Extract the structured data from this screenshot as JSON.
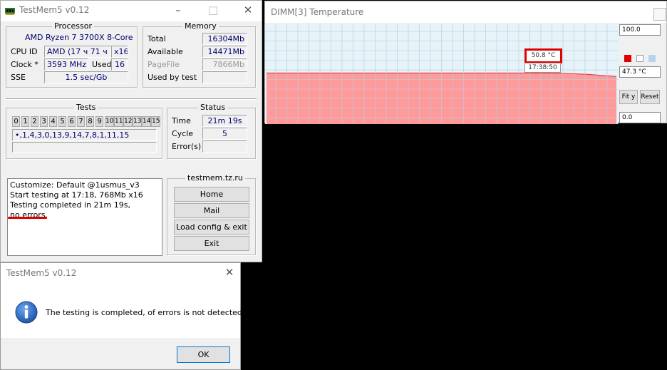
{
  "testmem": {
    "title": "TestMem5 v0.12",
    "processor": {
      "group": "Processor",
      "name": "AMD Ryzen 7 3700X 8-Core",
      "cpuid_label": "CPU ID",
      "cpuid_value": "AMD  (17 ч 71 ч",
      "cpuid_threads": "x16",
      "clock_label": "Clock *",
      "clock_value": "3593 MHz",
      "used_label": "Used",
      "used_value": "16",
      "sse_label": "SSE",
      "sse_value": "1.5 sec/Gb"
    },
    "memory": {
      "group": "Memory",
      "total_label": "Total",
      "total_value": "16304Mb",
      "available_label": "Available",
      "available_value": "14471Mb",
      "pagefile_label": "PageFile",
      "pagefile_value": "7866Mb",
      "used_by_test_label": "Used by test",
      "used_by_test_value": ""
    },
    "tests": {
      "group": "Tests",
      "cells": [
        "0",
        "1",
        "2",
        "3",
        "4",
        "5",
        "6",
        "7",
        "8",
        "9",
        "10",
        "11",
        "12",
        "13",
        "14",
        "15"
      ],
      "sequence": "•,1,4,3,0,13,9,14,7,8,1,11,15",
      "progress": 1.0
    },
    "status": {
      "group": "Status",
      "time_label": "Time",
      "time_value": "21m 19s",
      "cycle_label": "Cycle",
      "cycle_value": "5",
      "errors_label": "Error(s)",
      "errors_value": ""
    },
    "log": {
      "lines": [
        "Customize: Default @1usmus_v3",
        "Start testing at 17:18, 768Mb x16",
        "Testing completed in 21m 19s,",
        "no errors."
      ]
    },
    "links": {
      "group": "testmem.tz.ru",
      "home": "Home",
      "mail": "Mail",
      "load_config_exit": "Load config & exit",
      "exit": "Exit"
    },
    "accent": {
      "underline": "#e00000"
    }
  },
  "dimm": {
    "title": "DIMM[3] Temperature",
    "max_value": "100.0",
    "current_value": "47.3 °C",
    "min_value": "0.0",
    "fit_y": "Fit y",
    "reset": "Reset",
    "tooltip_temp": "50.8 °C",
    "tooltip_time": "17:38:50",
    "colors": {
      "fill": "#ff9a9a",
      "line": "#e03030",
      "grid_bg": "#e6f3f8",
      "highlight": "#e00000"
    }
  },
  "dialog": {
    "title": "TestMem5 v0.12",
    "message": "The testing is completed, of errors is not detected.",
    "ok": "OK",
    "icon": "info-icon"
  },
  "chart_data": {
    "type": "area",
    "title": "DIMM[3] Temperature",
    "ylim": [
      0,
      100
    ],
    "series": [
      {
        "values": [
          50.8,
          50.8,
          50.8,
          50.8,
          50.8,
          50.8,
          50.8,
          50.8,
          50.8,
          50.8,
          50.5,
          49.5,
          47.3
        ]
      }
    ],
    "grid": true
  }
}
